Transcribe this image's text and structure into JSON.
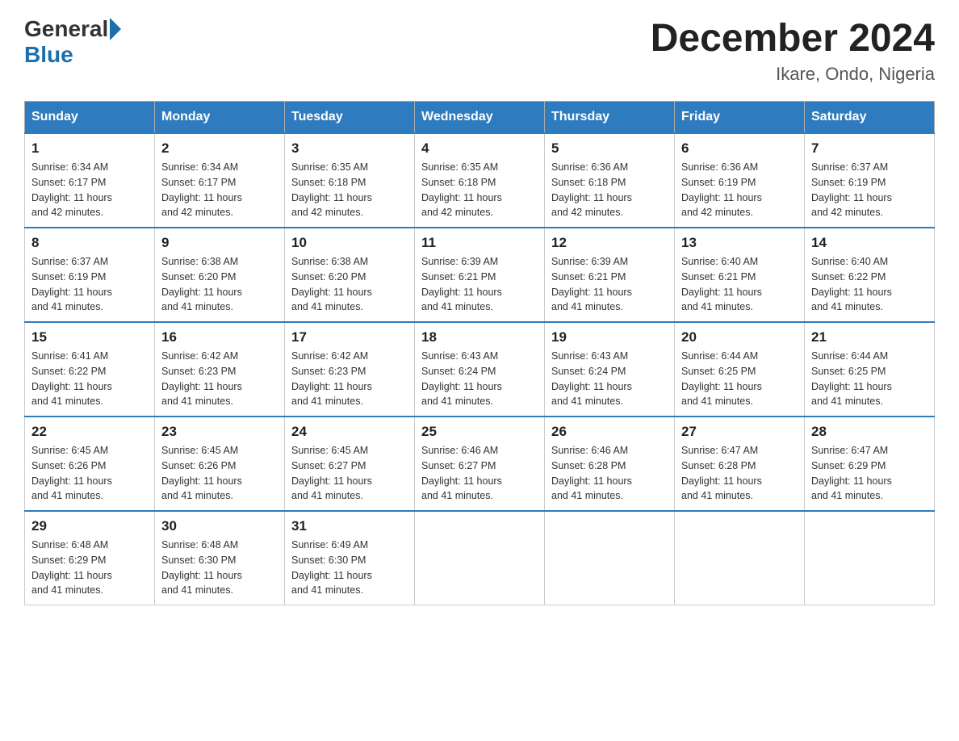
{
  "logo": {
    "general": "General",
    "blue": "Blue"
  },
  "title": "December 2024",
  "subtitle": "Ikare, Ondo, Nigeria",
  "days": [
    "Sunday",
    "Monday",
    "Tuesday",
    "Wednesday",
    "Thursday",
    "Friday",
    "Saturday"
  ],
  "weeks": [
    [
      {
        "num": "1",
        "sunrise": "6:34 AM",
        "sunset": "6:17 PM",
        "daylight": "11 hours and 42 minutes."
      },
      {
        "num": "2",
        "sunrise": "6:34 AM",
        "sunset": "6:17 PM",
        "daylight": "11 hours and 42 minutes."
      },
      {
        "num": "3",
        "sunrise": "6:35 AM",
        "sunset": "6:18 PM",
        "daylight": "11 hours and 42 minutes."
      },
      {
        "num": "4",
        "sunrise": "6:35 AM",
        "sunset": "6:18 PM",
        "daylight": "11 hours and 42 minutes."
      },
      {
        "num": "5",
        "sunrise": "6:36 AM",
        "sunset": "6:18 PM",
        "daylight": "11 hours and 42 minutes."
      },
      {
        "num": "6",
        "sunrise": "6:36 AM",
        "sunset": "6:19 PM",
        "daylight": "11 hours and 42 minutes."
      },
      {
        "num": "7",
        "sunrise": "6:37 AM",
        "sunset": "6:19 PM",
        "daylight": "11 hours and 42 minutes."
      }
    ],
    [
      {
        "num": "8",
        "sunrise": "6:37 AM",
        "sunset": "6:19 PM",
        "daylight": "11 hours and 41 minutes."
      },
      {
        "num": "9",
        "sunrise": "6:38 AM",
        "sunset": "6:20 PM",
        "daylight": "11 hours and 41 minutes."
      },
      {
        "num": "10",
        "sunrise": "6:38 AM",
        "sunset": "6:20 PM",
        "daylight": "11 hours and 41 minutes."
      },
      {
        "num": "11",
        "sunrise": "6:39 AM",
        "sunset": "6:21 PM",
        "daylight": "11 hours and 41 minutes."
      },
      {
        "num": "12",
        "sunrise": "6:39 AM",
        "sunset": "6:21 PM",
        "daylight": "11 hours and 41 minutes."
      },
      {
        "num": "13",
        "sunrise": "6:40 AM",
        "sunset": "6:21 PM",
        "daylight": "11 hours and 41 minutes."
      },
      {
        "num": "14",
        "sunrise": "6:40 AM",
        "sunset": "6:22 PM",
        "daylight": "11 hours and 41 minutes."
      }
    ],
    [
      {
        "num": "15",
        "sunrise": "6:41 AM",
        "sunset": "6:22 PM",
        "daylight": "11 hours and 41 minutes."
      },
      {
        "num": "16",
        "sunrise": "6:42 AM",
        "sunset": "6:23 PM",
        "daylight": "11 hours and 41 minutes."
      },
      {
        "num": "17",
        "sunrise": "6:42 AM",
        "sunset": "6:23 PM",
        "daylight": "11 hours and 41 minutes."
      },
      {
        "num": "18",
        "sunrise": "6:43 AM",
        "sunset": "6:24 PM",
        "daylight": "11 hours and 41 minutes."
      },
      {
        "num": "19",
        "sunrise": "6:43 AM",
        "sunset": "6:24 PM",
        "daylight": "11 hours and 41 minutes."
      },
      {
        "num": "20",
        "sunrise": "6:44 AM",
        "sunset": "6:25 PM",
        "daylight": "11 hours and 41 minutes."
      },
      {
        "num": "21",
        "sunrise": "6:44 AM",
        "sunset": "6:25 PM",
        "daylight": "11 hours and 41 minutes."
      }
    ],
    [
      {
        "num": "22",
        "sunrise": "6:45 AM",
        "sunset": "6:26 PM",
        "daylight": "11 hours and 41 minutes."
      },
      {
        "num": "23",
        "sunrise": "6:45 AM",
        "sunset": "6:26 PM",
        "daylight": "11 hours and 41 minutes."
      },
      {
        "num": "24",
        "sunrise": "6:45 AM",
        "sunset": "6:27 PM",
        "daylight": "11 hours and 41 minutes."
      },
      {
        "num": "25",
        "sunrise": "6:46 AM",
        "sunset": "6:27 PM",
        "daylight": "11 hours and 41 minutes."
      },
      {
        "num": "26",
        "sunrise": "6:46 AM",
        "sunset": "6:28 PM",
        "daylight": "11 hours and 41 minutes."
      },
      {
        "num": "27",
        "sunrise": "6:47 AM",
        "sunset": "6:28 PM",
        "daylight": "11 hours and 41 minutes."
      },
      {
        "num": "28",
        "sunrise": "6:47 AM",
        "sunset": "6:29 PM",
        "daylight": "11 hours and 41 minutes."
      }
    ],
    [
      {
        "num": "29",
        "sunrise": "6:48 AM",
        "sunset": "6:29 PM",
        "daylight": "11 hours and 41 minutes."
      },
      {
        "num": "30",
        "sunrise": "6:48 AM",
        "sunset": "6:30 PM",
        "daylight": "11 hours and 41 minutes."
      },
      {
        "num": "31",
        "sunrise": "6:49 AM",
        "sunset": "6:30 PM",
        "daylight": "11 hours and 41 minutes."
      },
      null,
      null,
      null,
      null
    ]
  ],
  "labels": {
    "sunrise": "Sunrise:",
    "sunset": "Sunset:",
    "daylight": "Daylight:"
  }
}
